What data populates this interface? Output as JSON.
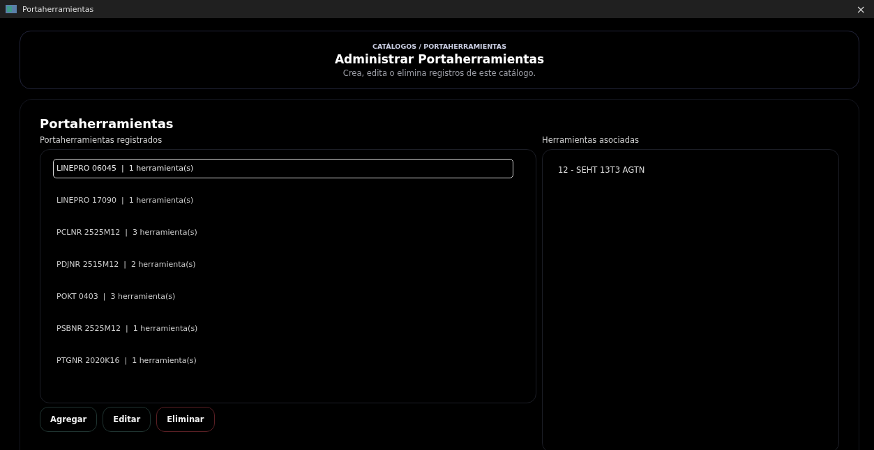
{
  "window": {
    "title": "Portaherramientas",
    "close": "×"
  },
  "header": {
    "breadcrumb": "CATÁLOGOS / PORTAHERRAMIENTAS",
    "title": "Administrar Portaherramientas",
    "subtitle": "Crea, edita o elimina registros de este catálogo."
  },
  "panel": {
    "title": "Portaherramientas",
    "list_label": "Portaherramientas registrados",
    "tools_label": "Herramientas asociadas"
  },
  "holders": [
    {
      "label": "LINEPRO 06045  |  1 herramienta(s)",
      "selected": true
    },
    {
      "label": "LINEPRO 17090  |  1 herramienta(s)",
      "selected": false
    },
    {
      "label": "PCLNR 2525M12  |  3 herramienta(s)",
      "selected": false
    },
    {
      "label": "PDJNR 2515M12  |  2 herramienta(s)",
      "selected": false
    },
    {
      "label": "POKT 0403  |  3 herramienta(s)",
      "selected": false
    },
    {
      "label": "PSBNR 2525M12  |  1 herramienta(s)",
      "selected": false
    },
    {
      "label": "PTGNR 2020K16  |  1 herramienta(s)",
      "selected": false
    }
  ],
  "tools": [
    "12 - SEHT 13T3 AGTN"
  ],
  "buttons": [
    {
      "label": "Agregar",
      "kind": "normal"
    },
    {
      "label": "Editar",
      "kind": "normal"
    },
    {
      "label": "Eliminar",
      "kind": "danger"
    }
  ]
}
